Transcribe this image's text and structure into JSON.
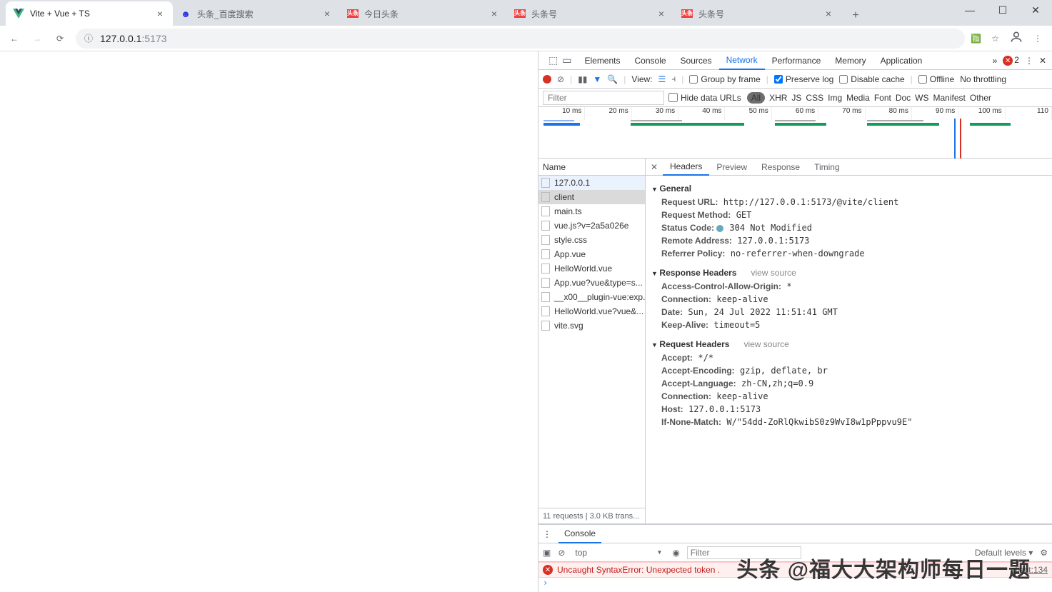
{
  "window": {
    "minimize": "—",
    "maximize": "☐",
    "close": "✕"
  },
  "tabs": [
    {
      "title": "Vite + Vue + TS",
      "icon": "vue"
    },
    {
      "title": "头条_百度搜索",
      "icon": "baidu"
    },
    {
      "title": "今日头条",
      "icon": "toutiao"
    },
    {
      "title": "头条号",
      "icon": "toutiao"
    },
    {
      "title": "头条号",
      "icon": "toutiao"
    }
  ],
  "newtab": "+",
  "address": {
    "host": "127.0.0.1",
    "port": ":5173",
    "info": "ⓘ"
  },
  "nav": {
    "back": "←",
    "forward": "→",
    "reload": "⟳"
  },
  "addr_icons": {
    "translate": "文",
    "star": "☆",
    "profile": "",
    "menu": "⋮"
  },
  "devtools_tabs": [
    "Elements",
    "Console",
    "Sources",
    "Network",
    "Performance",
    "Memory",
    "Application"
  ],
  "devtools_more": "»",
  "error_count": "2",
  "nt_toolbar": {
    "view": "View:",
    "group": "Group by frame",
    "preserve": "Preserve log",
    "disable": "Disable cache",
    "offline": "Offline",
    "throttle": "No throttling"
  },
  "filter": {
    "placeholder": "Filter",
    "hide": "Hide data URLs",
    "chips": [
      "All",
      "XHR",
      "JS",
      "CSS",
      "Img",
      "Media",
      "Font",
      "Doc",
      "WS",
      "Manifest",
      "Other"
    ]
  },
  "timeline_ticks": [
    "10 ms",
    "20 ms",
    "30 ms",
    "40 ms",
    "50 ms",
    "60 ms",
    "70 ms",
    "80 ms",
    "90 ms",
    "100 ms",
    "110"
  ],
  "req_header": "Name",
  "requests": [
    "127.0.0.1",
    "client",
    "main.ts",
    "vue.js?v=2a5a026e",
    "style.css",
    "App.vue",
    "HelloWorld.vue",
    "App.vue?vue&type=s...",
    "__x00__plugin-vue:exp...",
    "HelloWorld.vue?vue&...",
    "vite.svg"
  ],
  "req_selected": 1,
  "req_highlight": 0,
  "req_footer": "11 requests | 3.0 KB trans...",
  "detail_tabs": [
    "Headers",
    "Preview",
    "Response",
    "Timing"
  ],
  "detail_close": "✕",
  "general": {
    "title": "General",
    "items": [
      {
        "k": "Request URL:",
        "v": "http://127.0.0.1:5173/@vite/client"
      },
      {
        "k": "Request Method:",
        "v": "GET"
      },
      {
        "k": "Status Code:",
        "v": "304 Not Modified",
        "dot": true
      },
      {
        "k": "Remote Address:",
        "v": "127.0.0.1:5173"
      },
      {
        "k": "Referrer Policy:",
        "v": "no-referrer-when-downgrade"
      }
    ]
  },
  "resp_headers": {
    "title": "Response Headers",
    "vs": "view source",
    "items": [
      {
        "k": "Access-Control-Allow-Origin:",
        "v": "*"
      },
      {
        "k": "Connection:",
        "v": "keep-alive"
      },
      {
        "k": "Date:",
        "v": "Sun, 24 Jul 2022 11:51:41 GMT"
      },
      {
        "k": "Keep-Alive:",
        "v": "timeout=5"
      }
    ]
  },
  "req_headers": {
    "title": "Request Headers",
    "vs": "view source",
    "items": [
      {
        "k": "Accept:",
        "v": "*/*"
      },
      {
        "k": "Accept-Encoding:",
        "v": "gzip, deflate, br"
      },
      {
        "k": "Accept-Language:",
        "v": "zh-CN,zh;q=0.9"
      },
      {
        "k": "Connection:",
        "v": "keep-alive"
      },
      {
        "k": "Host:",
        "v": "127.0.0.1:5173"
      },
      {
        "k": "If-None-Match:",
        "v": "W/\"54dd-ZoRlQkwibS0z9WvI8w1pPppvu9E\""
      }
    ]
  },
  "drawer": {
    "tab": "Console",
    "context": "top",
    "filter_ph": "Filter",
    "levels": "Default levels ▾",
    "error": "Uncaught SyntaxError: Unexpected token .",
    "error_loc": "client:134",
    "prompt": "›"
  },
  "watermark": "头条 @福大大架构师每日一题"
}
